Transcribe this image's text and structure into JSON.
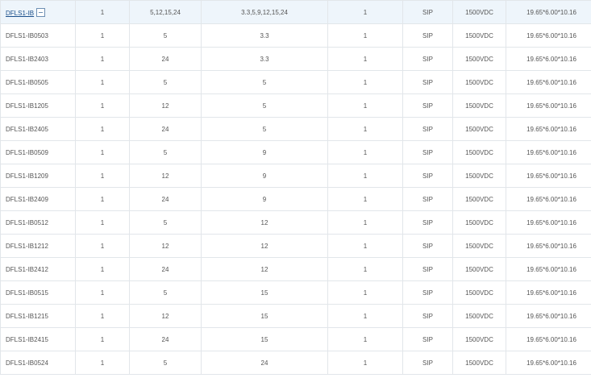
{
  "group_row": {
    "model": "DFLS1-IB",
    "outputs": "1",
    "vin": "5,12,15,24",
    "vout": "3.3,5,9,12,15,24",
    "power": "1",
    "package": "SIP",
    "isolation": "1500VDC",
    "dimensions": "19.65*6.00*10.16"
  },
  "rows": [
    {
      "model": "DFLS1-IB0503",
      "outputs": "1",
      "vin": "5",
      "vout": "3.3",
      "power": "1",
      "package": "SIP",
      "isolation": "1500VDC",
      "dimensions": "19.65*6.00*10.16"
    },
    {
      "model": "DFLS1-IB2403",
      "outputs": "1",
      "vin": "24",
      "vout": "3.3",
      "power": "1",
      "package": "SIP",
      "isolation": "1500VDC",
      "dimensions": "19.65*6.00*10.16"
    },
    {
      "model": "DFLS1-IB0505",
      "outputs": "1",
      "vin": "5",
      "vout": "5",
      "power": "1",
      "package": "SIP",
      "isolation": "1500VDC",
      "dimensions": "19.65*6.00*10.16"
    },
    {
      "model": "DFLS1-IB1205",
      "outputs": "1",
      "vin": "12",
      "vout": "5",
      "power": "1",
      "package": "SIP",
      "isolation": "1500VDC",
      "dimensions": "19.65*6.00*10.16"
    },
    {
      "model": "DFLS1-IB2405",
      "outputs": "1",
      "vin": "24",
      "vout": "5",
      "power": "1",
      "package": "SIP",
      "isolation": "1500VDC",
      "dimensions": "19.65*6.00*10.16"
    },
    {
      "model": "DFLS1-IB0509",
      "outputs": "1",
      "vin": "5",
      "vout": "9",
      "power": "1",
      "package": "SIP",
      "isolation": "1500VDC",
      "dimensions": "19.65*6.00*10.16"
    },
    {
      "model": "DFLS1-IB1209",
      "outputs": "1",
      "vin": "12",
      "vout": "9",
      "power": "1",
      "package": "SIP",
      "isolation": "1500VDC",
      "dimensions": "19.65*6.00*10.16"
    },
    {
      "model": "DFLS1-IB2409",
      "outputs": "1",
      "vin": "24",
      "vout": "9",
      "power": "1",
      "package": "SIP",
      "isolation": "1500VDC",
      "dimensions": "19.65*6.00*10.16"
    },
    {
      "model": "DFLS1-IB0512",
      "outputs": "1",
      "vin": "5",
      "vout": "12",
      "power": "1",
      "package": "SIP",
      "isolation": "1500VDC",
      "dimensions": "19.65*6.00*10.16"
    },
    {
      "model": "DFLS1-IB1212",
      "outputs": "1",
      "vin": "12",
      "vout": "12",
      "power": "1",
      "package": "SIP",
      "isolation": "1500VDC",
      "dimensions": "19.65*6.00*10.16"
    },
    {
      "model": "DFLS1-IB2412",
      "outputs": "1",
      "vin": "24",
      "vout": "12",
      "power": "1",
      "package": "SIP",
      "isolation": "1500VDC",
      "dimensions": "19.65*6.00*10.16"
    },
    {
      "model": "DFLS1-IB0515",
      "outputs": "1",
      "vin": "5",
      "vout": "15",
      "power": "1",
      "package": "SIP",
      "isolation": "1500VDC",
      "dimensions": "19.65*6.00*10.16"
    },
    {
      "model": "DFLS1-IB1215",
      "outputs": "1",
      "vin": "12",
      "vout": "15",
      "power": "1",
      "package": "SIP",
      "isolation": "1500VDC",
      "dimensions": "19.65*6.00*10.16"
    },
    {
      "model": "DFLS1-IB2415",
      "outputs": "1",
      "vin": "24",
      "vout": "15",
      "power": "1",
      "package": "SIP",
      "isolation": "1500VDC",
      "dimensions": "19.65*6.00*10.16"
    },
    {
      "model": "DFLS1-IB0524",
      "outputs": "1",
      "vin": "5",
      "vout": "24",
      "power": "1",
      "package": "SIP",
      "isolation": "1500VDC",
      "dimensions": "19.65*6.00*10.16"
    }
  ],
  "colors": {
    "group_row_background": "#eef5fb",
    "link": "#1a4f8b",
    "border": "#e2e6ea",
    "text": "#555555"
  },
  "icons": {
    "collapse_toggle": "minus-square-icon"
  }
}
